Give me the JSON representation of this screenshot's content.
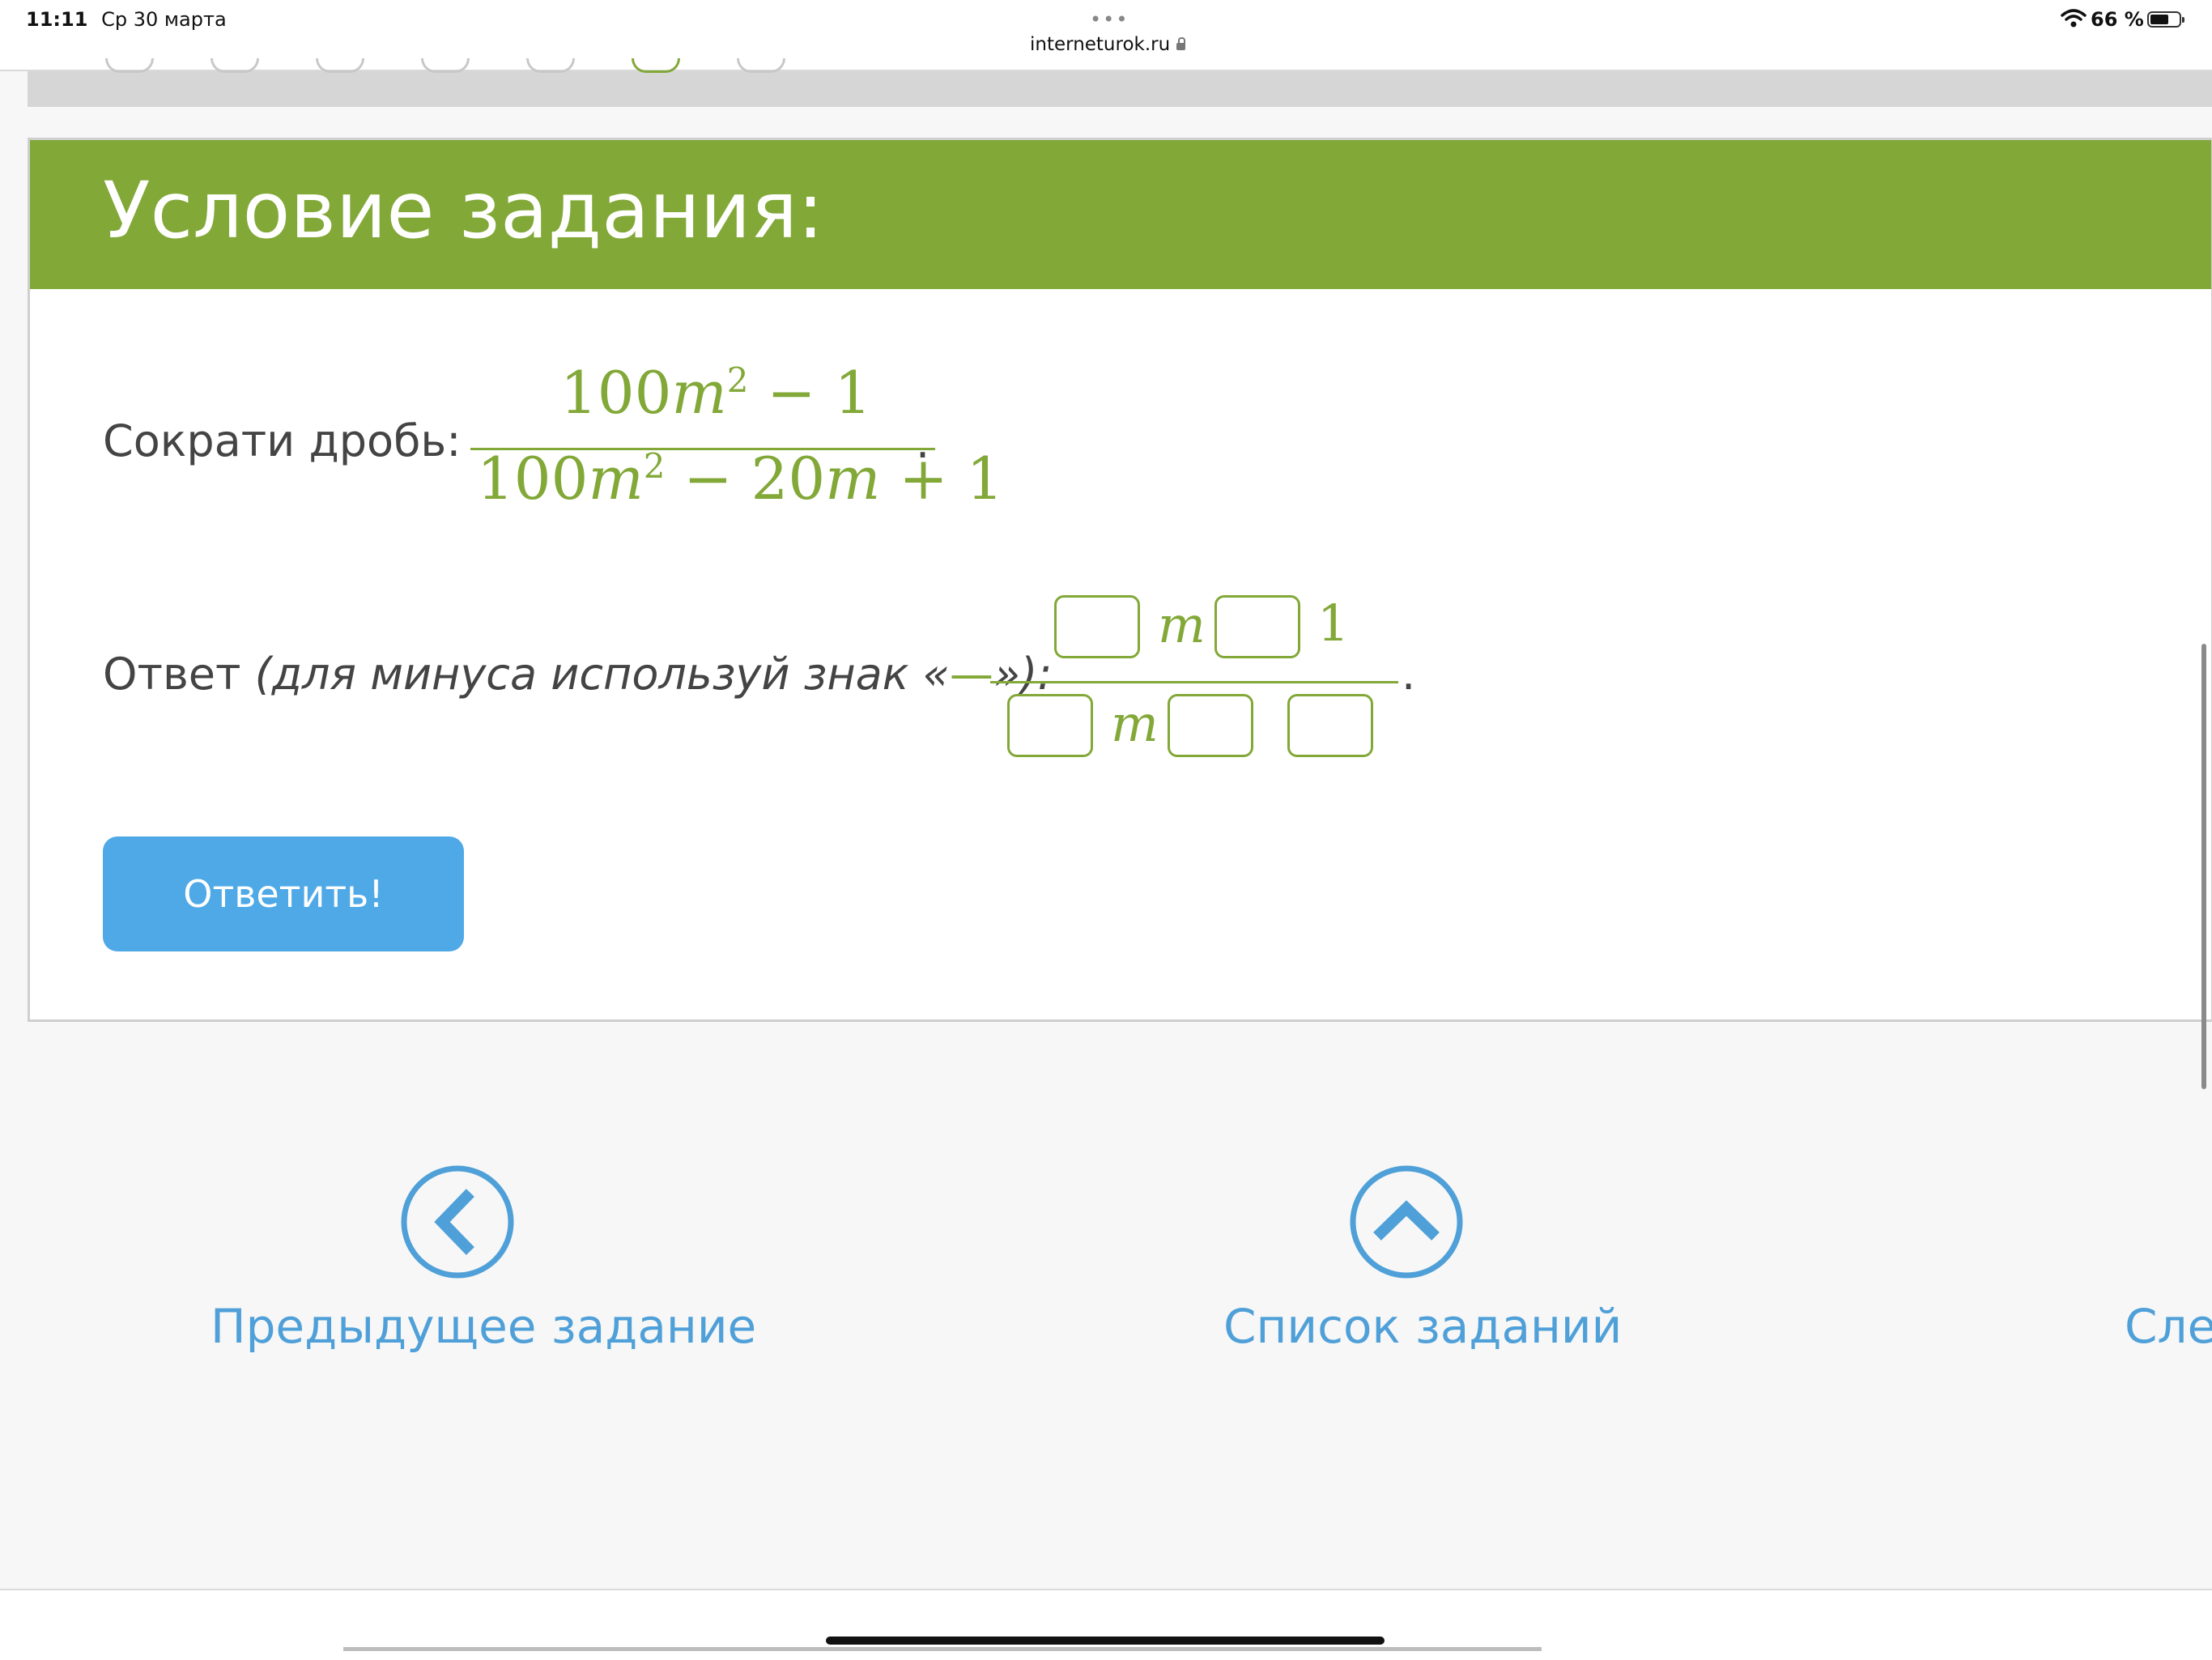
{
  "status_bar": {
    "time": "11:11",
    "date": "Ср 30 марта",
    "url": "interneturok.ru",
    "battery_percent": "66 %",
    "battery_level": 0.66
  },
  "task": {
    "title": "Условие задания:",
    "problem_label": "Сократи дробь:",
    "numerator": {
      "coef": "100",
      "var": "m",
      "exp": "2",
      "rest": " − 1"
    },
    "denominator": {
      "coef": "100",
      "var": "m",
      "exp": "2",
      "mid": " − 20",
      "var2": "m",
      "rest": " + 1"
    },
    "period": ".",
    "answer_label": "Ответ",
    "answer_hint_prefix": "(для минуса используй знак «",
    "answer_hint_minus": "—",
    "answer_hint_suffix": "»):",
    "answer_var": "m",
    "answer_one": "1",
    "submit_label": "Ответить!"
  },
  "nav": {
    "prev_label": "Предыдущее задание",
    "list_label": "Список заданий",
    "next_label": "Сле"
  },
  "colors": {
    "green": "#82a838",
    "blue": "#4fa9e6",
    "nav_blue": "#4fa0d8"
  }
}
